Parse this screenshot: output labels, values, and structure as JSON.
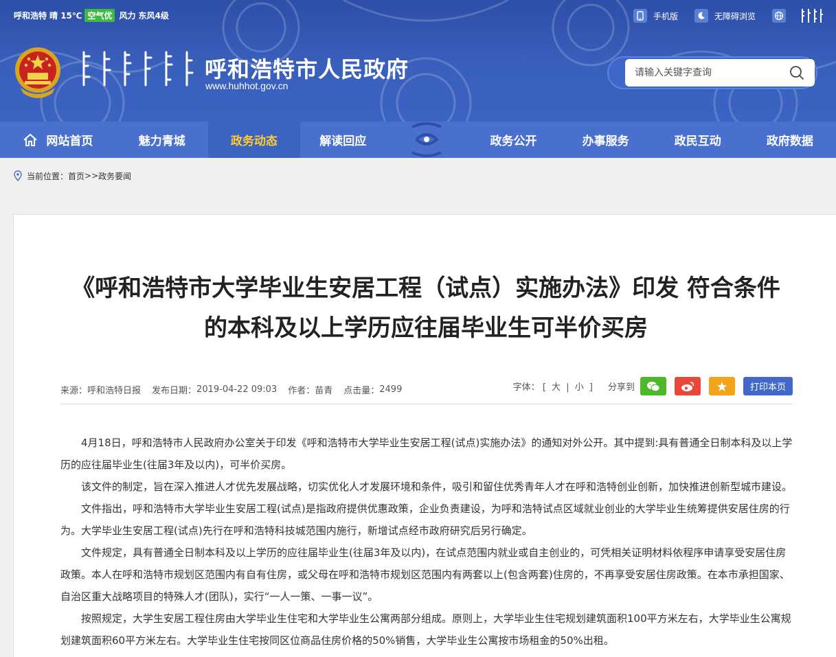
{
  "topbar": {
    "city": "呼和浩特",
    "weather": "晴 15℃",
    "air_quality": "空气优",
    "wind_label": "风力",
    "wind_value": "东风4级"
  },
  "toplinks": {
    "mobile": "手机版",
    "accessible": "无障碍浏览"
  },
  "header": {
    "title": "呼和浩特市人民政府",
    "url": "www.huhhot.gov.cn"
  },
  "search": {
    "placeholder": "请输入关键字查询"
  },
  "nav": {
    "items": [
      {
        "label": "网站首页"
      },
      {
        "label": "魅力青城"
      },
      {
        "label": "政务动态"
      },
      {
        "label": "解读回应"
      },
      {
        "label": "政务公开"
      },
      {
        "label": "办事服务"
      },
      {
        "label": "政民互动"
      },
      {
        "label": "政府数据"
      }
    ]
  },
  "breadcrumb": {
    "prefix": "当前位置：",
    "home": "首页",
    "sep": ">>",
    "current": "政务要闻"
  },
  "article": {
    "title": "《呼和浩特市大学毕业生安居工程（试点）实施办法》印发 符合条件的本科及以上学历应往届毕业生可半价买房",
    "source_label": "来源：",
    "source": "呼和浩特日报",
    "date_label": "发布日期：",
    "date": "2019-04-22 09:03",
    "author_label": "作者：",
    "author": "苗青",
    "clicks_label": "点击量：",
    "clicks": "2499",
    "font_label": "字体：",
    "font_open": "[",
    "font_large": "大",
    "font_sep": "|",
    "font_small": "小",
    "font_close": "]",
    "share_label": "分享到",
    "print_label": "打印本页",
    "paragraphs": [
      "4月18日，呼和浩特市人民政府办公室关于印发《呼和浩特市大学毕业生安居工程(试点)实施办法》的通知对外公开。其中提到:具有普通全日制本科及以上学历的应往届毕业生(往届3年及以内)，可半价买房。",
      "该文件的制定，旨在深入推进人才优先发展战略，切实优化人才发展环境和条件，吸引和留住优秀青年人才在呼和浩特创业创新，加快推进创新型城市建设。",
      "文件指出，呼和浩特市大学毕业生安居工程(试点)是指政府提供优惠政策，企业负责建设，为呼和浩特试点区域就业创业的大学毕业生统筹提供安居住房的行为。大学毕业生安居工程(试点)先行在呼和浩特科技城范围内施行，新增试点经市政府研究后另行确定。",
      "文件规定，具有普通全日制本科及以上学历的应往届毕业生(往届3年及以内)，在试点范围内就业或自主创业的，可凭相关证明材料依程序申请享受安居住房政策。本人在呼和浩特市规划区范围内有自有住房，或父母在呼和浩特市规划区范围内有两套以上(包含两套)住房的，不再享受安居住房政策。在本市承担国家、自治区重大战略项目的特殊人才(团队)，实行“一人一策、一事一议”。",
      "按照规定，大学生安居工程住房由大学毕业生住宅和大学毕业生公寓两部分组成。原则上，大学毕业生住宅规划建筑面积100平方米左右，大学毕业生公寓规划建筑面积60平方米左右。大学毕业生住宅按同区位商品住房价格的50%销售，大学毕业生公寓按市场租金的50%出租。"
    ]
  },
  "colors": {
    "header_blue": "#3a60bd",
    "nav_blue": "#4a70cf",
    "active_yellow": "#ffcc33",
    "wechat_green": "#4cb82a",
    "weibo_red": "#e8483b",
    "fav_orange": "#f4a31b",
    "print_blue": "#4269c9"
  },
  "icons": [
    "mobile-icon",
    "accessibility-icon",
    "globe-icon",
    "national-emblem-icon",
    "search-icon",
    "home-icon",
    "location-pin-icon",
    "wechat-icon",
    "weibo-icon",
    "star-icon"
  ]
}
